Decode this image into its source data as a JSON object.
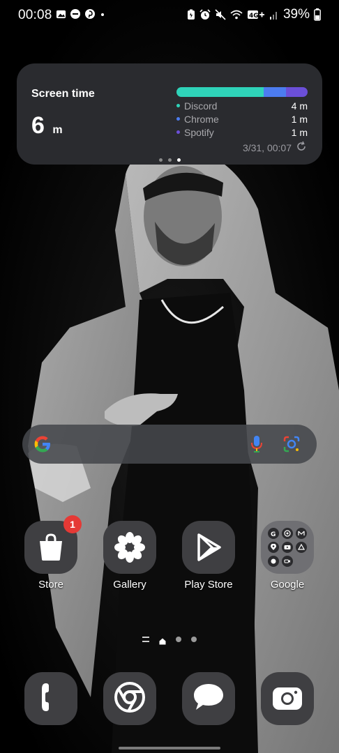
{
  "status_bar": {
    "time": "00:08",
    "battery": "39%"
  },
  "screen_time": {
    "title": "Screen time",
    "total_value": "6",
    "total_unit": "m",
    "apps": [
      {
        "name": "Discord",
        "value": "4 m",
        "color": "#2fd3b9"
      },
      {
        "name": "Chrome",
        "value": "1 m",
        "color": "#4c7cf0"
      },
      {
        "name": "Spotify",
        "value": "1 m",
        "color": "#6b4fd8"
      }
    ],
    "updated": "3/31, 00:07"
  },
  "apps": [
    {
      "label": "Store",
      "badge": "1"
    },
    {
      "label": "Gallery"
    },
    {
      "label": "Play Store"
    },
    {
      "label": "Google"
    }
  ]
}
